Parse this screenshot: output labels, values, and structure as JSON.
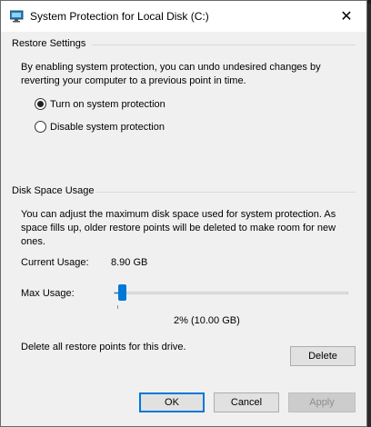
{
  "window": {
    "title": "System Protection for Local Disk (C:)",
    "icon": "system-properties-icon",
    "close_glyph": "✕"
  },
  "restore_settings": {
    "title": "Restore Settings",
    "description": "By enabling system protection, you can undo undesired changes by reverting your computer to a previous point in time.",
    "options": [
      {
        "label": "Turn on system protection",
        "selected": true
      },
      {
        "label": "Disable system protection",
        "selected": false
      }
    ]
  },
  "disk_space": {
    "title": "Disk Space Usage",
    "description": "You can adjust the maximum disk space used for system protection. As space fills up, older restore points will be deleted to make room for new ones.",
    "current_usage_label": "Current Usage:",
    "current_usage_value": "8.90 GB",
    "max_usage_label": "Max Usage:",
    "max_usage_percent": 2,
    "max_usage_readout": "2% (10.00 GB)",
    "delete_text": "Delete all restore points for this drive.",
    "delete_label": "Delete"
  },
  "buttons": {
    "ok": "OK",
    "cancel": "Cancel",
    "apply": "Apply"
  },
  "colors": {
    "accent": "#0078d7",
    "window_bg": "#f0f0f0",
    "disabled_bg": "#cccccc"
  }
}
